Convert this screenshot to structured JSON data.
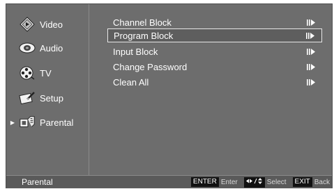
{
  "sidebar": {
    "items": [
      {
        "label": "Video",
        "icon": "video-icon",
        "active": false
      },
      {
        "label": "Audio",
        "icon": "speaker-icon",
        "active": false
      },
      {
        "label": "TV",
        "icon": "tv-reel-icon",
        "active": false
      },
      {
        "label": "Setup",
        "icon": "setup-icon",
        "active": false
      },
      {
        "label": "Parental",
        "icon": "parental-icon",
        "active": true
      }
    ]
  },
  "submenu": {
    "items": [
      {
        "label": "Channel Block",
        "selected": false
      },
      {
        "label": "Program Block",
        "selected": true
      },
      {
        "label": "Input Block",
        "selected": false
      },
      {
        "label": "Change Password",
        "selected": false
      },
      {
        "label": "Clean All",
        "selected": false
      }
    ]
  },
  "status_bar": {
    "title": "Parental",
    "enter_key": "ENTER",
    "enter_text": "Enter",
    "select_text": "Select",
    "exit_key": "EXIT",
    "exit_text": "Back"
  },
  "colors": {
    "panel": "#6d6d6d",
    "status_bar": "#5a5a5a",
    "key_background": "#111111"
  }
}
